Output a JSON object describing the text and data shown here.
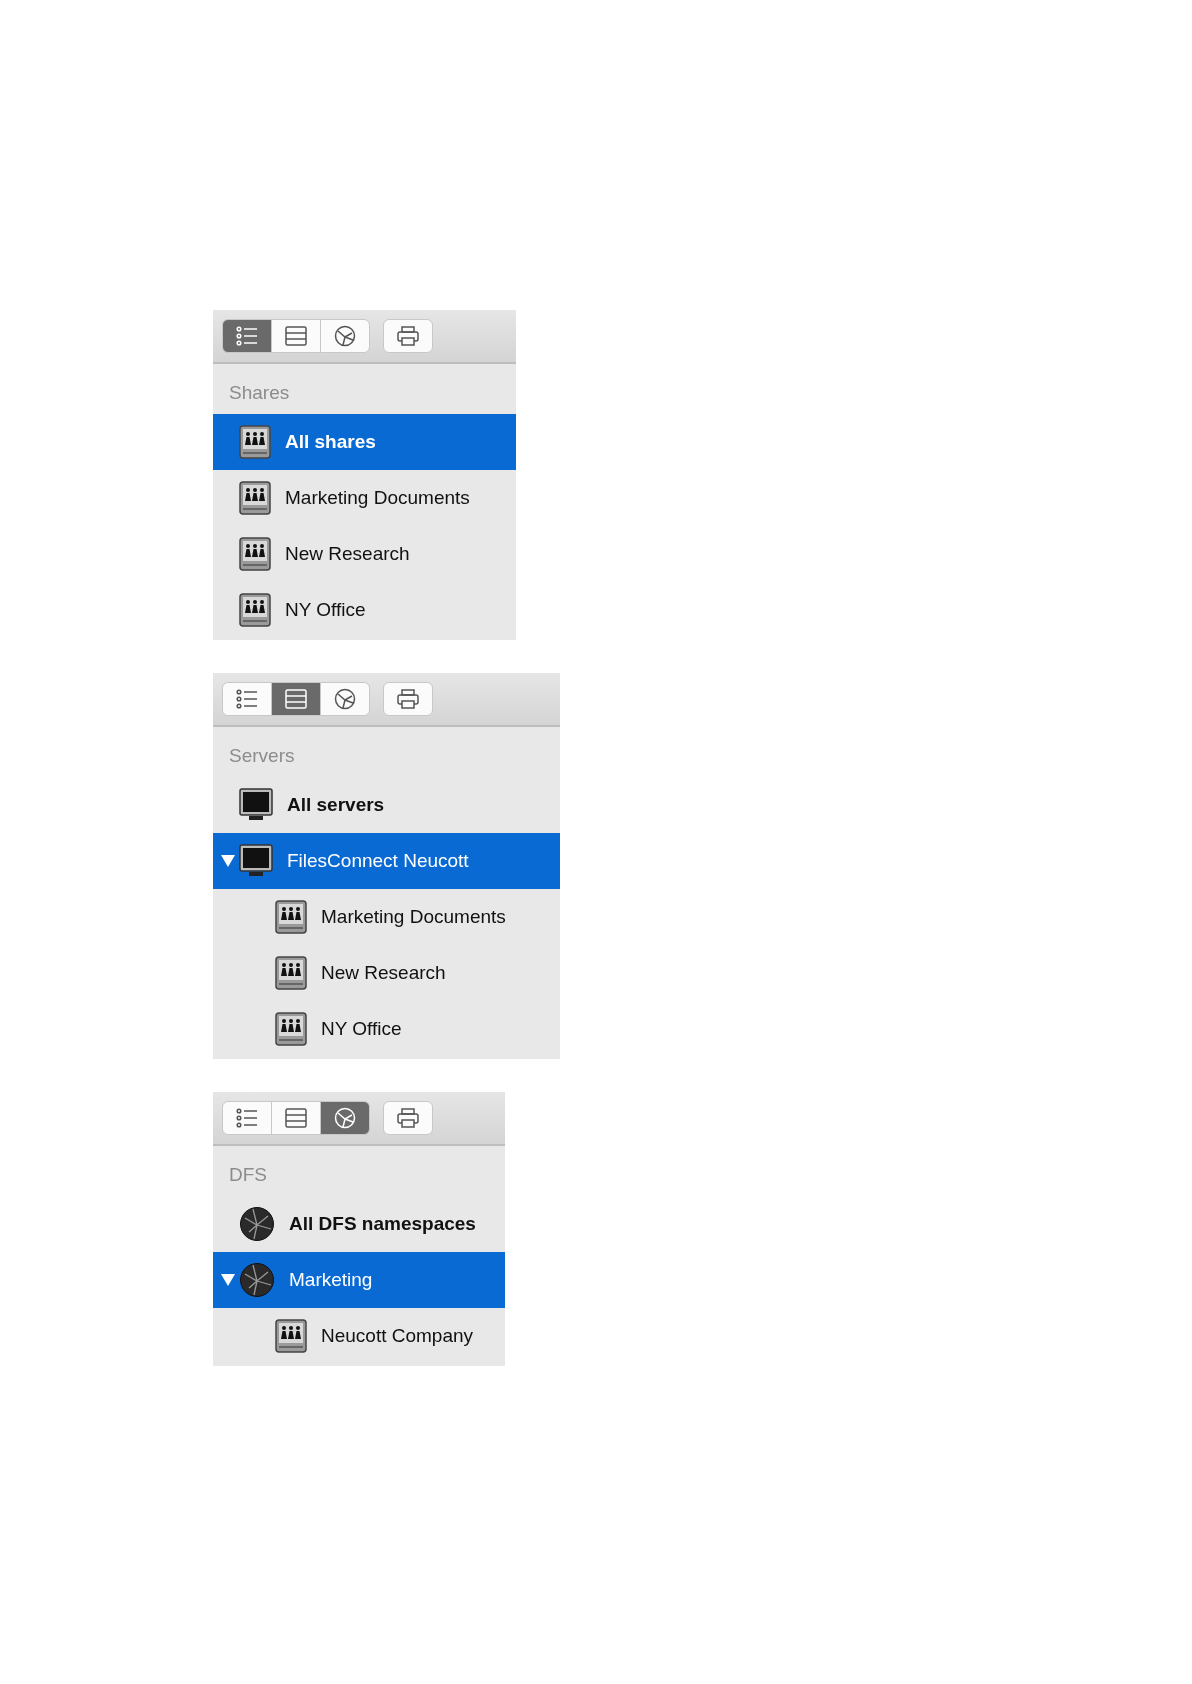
{
  "panels": [
    {
      "toolbar": {
        "views": [
          {
            "kind": "list",
            "selected": true
          },
          {
            "kind": "servers",
            "selected": false
          },
          {
            "kind": "dfs",
            "selected": false
          }
        ]
      },
      "section": "Shares",
      "items": [
        {
          "label": "All shares",
          "kind": "share",
          "bold": true,
          "selected": true
        },
        {
          "label": "Marketing Documents",
          "kind": "share",
          "bold": false,
          "selected": false
        },
        {
          "label": "New Research",
          "kind": "share",
          "bold": false,
          "selected": false
        },
        {
          "label": "NY Office",
          "kind": "share",
          "bold": false,
          "selected": false
        }
      ]
    },
    {
      "toolbar": {
        "views": [
          {
            "kind": "list",
            "selected": false
          },
          {
            "kind": "servers",
            "selected": true
          },
          {
            "kind": "dfs",
            "selected": false
          }
        ]
      },
      "section": "Servers",
      "items": [
        {
          "label": "All servers",
          "kind": "server",
          "bold": true,
          "selected": false
        },
        {
          "label": "FilesConnect Neucott",
          "kind": "server",
          "bold": false,
          "selected": true,
          "expanded": true,
          "children": [
            {
              "label": "Marketing Documents",
              "kind": "share",
              "bold": false,
              "selected": false
            },
            {
              "label": "New Research",
              "kind": "share",
              "bold": false,
              "selected": false
            },
            {
              "label": "NY Office",
              "kind": "share",
              "bold": false,
              "selected": false
            }
          ]
        }
      ]
    },
    {
      "toolbar": {
        "views": [
          {
            "kind": "list",
            "selected": false
          },
          {
            "kind": "servers",
            "selected": false
          },
          {
            "kind": "dfs",
            "selected": true
          }
        ]
      },
      "section": "DFS",
      "items": [
        {
          "label": "All DFS namespaces",
          "kind": "globe",
          "bold": true,
          "selected": false
        },
        {
          "label": "Marketing",
          "kind": "globe",
          "bold": false,
          "selected": true,
          "expanded": true,
          "children": [
            {
              "label": "Neucott Company",
              "kind": "share",
              "bold": false,
              "selected": false
            }
          ]
        }
      ]
    }
  ]
}
